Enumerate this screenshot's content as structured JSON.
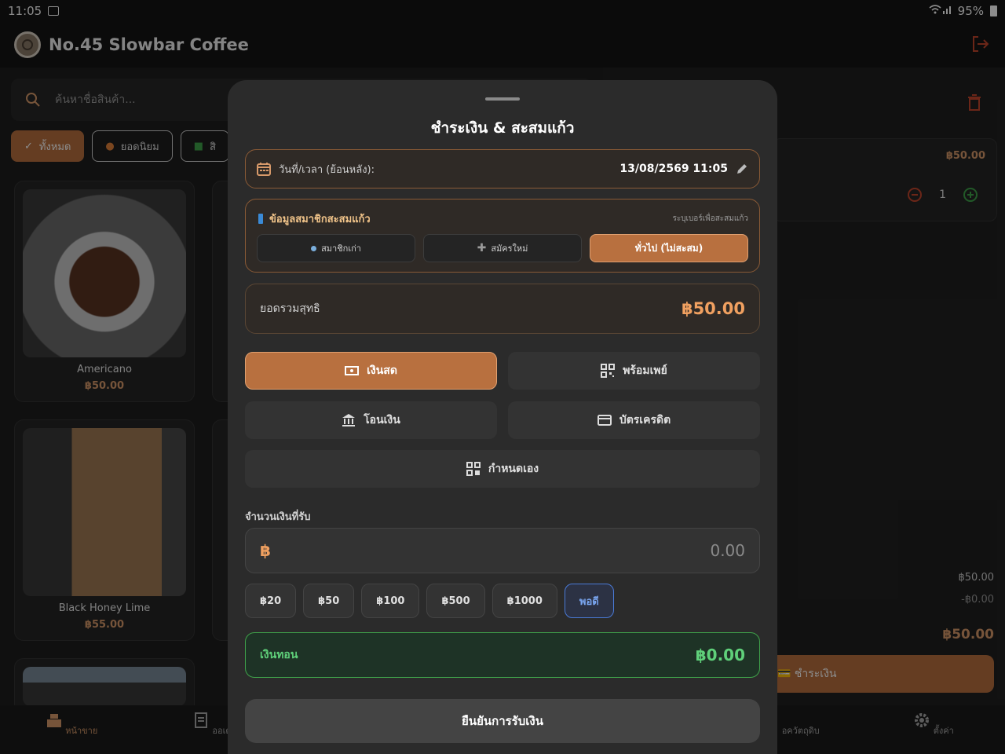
{
  "statusbar": {
    "time": "11:05",
    "battery": "95%"
  },
  "app": {
    "title": "No.45 Slowbar Coffee"
  },
  "search": {
    "placeholder": "ค้นหาชื่อสินค้า..."
  },
  "categories": [
    {
      "label": "ทั้งหมด",
      "active": true
    },
    {
      "label": "ยอดนิยม",
      "active": false
    },
    {
      "label": "สิ",
      "active": false
    }
  ],
  "products": [
    {
      "name": "Americano",
      "price": "฿50.00"
    },
    {
      "name": "Black Honey Lime",
      "price": "฿55.00"
    }
  ],
  "cart": {
    "item_price": "฿50.00",
    "qty": "1",
    "subtotal": "฿50.00",
    "discount": "-฿0.00",
    "total": "฿50.00",
    "pay_label": "💳 ชำระเงิน"
  },
  "bottomnav": [
    {
      "label": "หน้าขาย",
      "icon": "register-icon",
      "active": true
    },
    {
      "label": "ออเดอ",
      "icon": "receipt-icon",
      "active": false
    },
    {
      "label": "อควัตถุดิบ",
      "icon": "inventory-icon",
      "active": false
    },
    {
      "label": "ตั้งค่า",
      "icon": "gear-icon",
      "active": false
    }
  ],
  "modal": {
    "title": "ชำระเงิน & สะสมแก้ว",
    "date_label": "วันที่/เวลา (ย้อนหลัง):",
    "date_value": "13/08/2569 11:05",
    "member": {
      "title": "ข้อมูลสมาชิกสะสมแก้ว",
      "hint": "ระบุเบอร์เพื่อสะสมแก้ว",
      "options": [
        {
          "label": "สมาชิกเก่า",
          "active": false
        },
        {
          "label": "สมัครใหม่",
          "active": false
        },
        {
          "label": "ทั่วไป (ไม่สะสม)",
          "active": true
        }
      ]
    },
    "net_total_label": "ยอดรวมสุทธิ",
    "net_total": "฿50.00",
    "methods": {
      "cash": "เงินสด",
      "promptpay": "พร้อมเพย์",
      "transfer": "โอนเงิน",
      "credit": "บัตรเครดิต",
      "custom": "กำหนดเอง"
    },
    "received_label": "จำนวนเงินที่รับ",
    "currency": "฿",
    "received_placeholder": "0.00",
    "quick_amounts": [
      "฿20",
      "฿50",
      "฿100",
      "฿500",
      "฿1000",
      "พอดี"
    ],
    "change_label": "เงินทอน",
    "change_value": "฿0.00",
    "confirm_label": "ยืนยันการรับเงิน"
  },
  "colors": {
    "accent": "#b8703f",
    "success": "#3fa24a",
    "danger": "#c4452c"
  }
}
